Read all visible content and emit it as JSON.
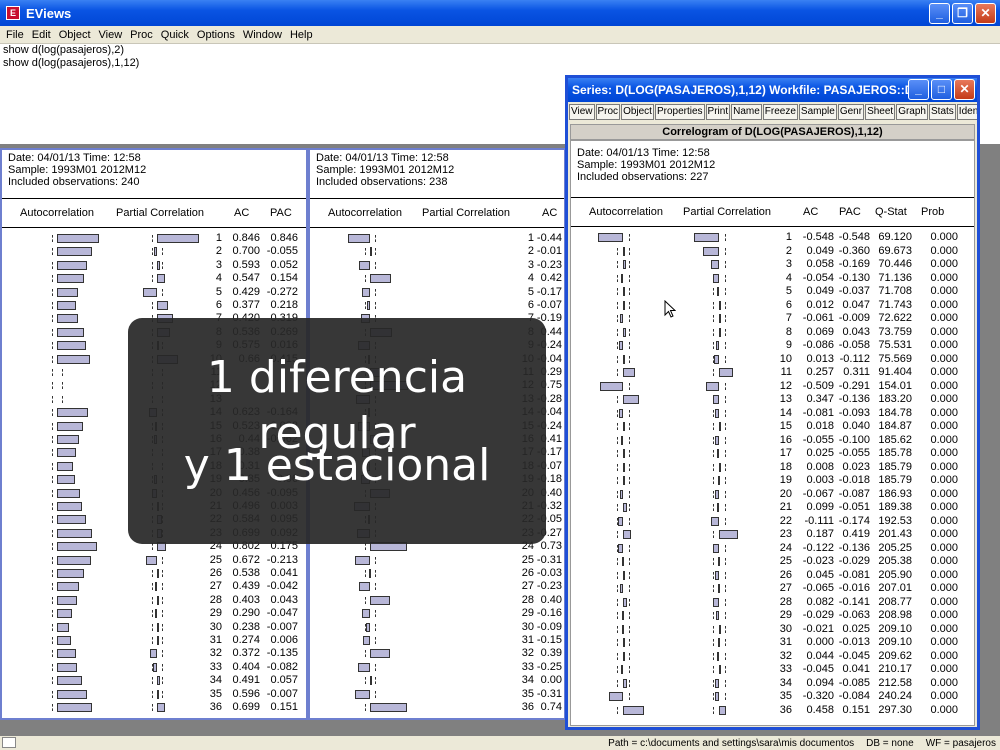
{
  "app": {
    "title": "EViews",
    "icon": "eviews-app-icon"
  },
  "menu": [
    "File",
    "Edit",
    "Object",
    "View",
    "Proc",
    "Quick",
    "Options",
    "Window",
    "Help"
  ],
  "commands": [
    "show d(log(pasajeros),2)",
    "show d(log(pasajeros),1,12)"
  ],
  "status": {
    "path": "Path = c:\\documents and settings\\sara\\mis documentos",
    "db": "DB = none",
    "wf": "WF = pasajeros"
  },
  "headers": {
    "autocorrelation": "Autocorrelation",
    "partial": "Partial Correlation",
    "ac": "AC",
    "pac": "PAC",
    "qstat": "Q-Stat",
    "prob": "Prob"
  },
  "win1": {
    "date": "Date: 04/01/13   Time: 12:58",
    "sample": "Sample: 1993M01 2012M12",
    "obs": "Included observations: 240",
    "rows": [
      {
        "lag": "1",
        "ac": "0.846",
        "pac": "0.846"
      },
      {
        "lag": "2",
        "ac": "0.700",
        "pac": "-0.055"
      },
      {
        "lag": "3",
        "ac": "0.593",
        "pac": "0.052"
      },
      {
        "lag": "4",
        "ac": "0.547",
        "pac": "0.154"
      },
      {
        "lag": "5",
        "ac": "0.429",
        "pac": "-0.272"
      },
      {
        "lag": "6",
        "ac": "0.377",
        "pac": "0.218"
      },
      {
        "lag": "7",
        "ac": "0.420",
        "pac": "0.319"
      },
      {
        "lag": "8",
        "ac": "0.536",
        "pac": "0.269"
      },
      {
        "lag": "9",
        "ac": "0.575",
        "pac": "0.016"
      },
      {
        "lag": "10",
        "ac": "0.66",
        "pac": "0.415"
      },
      {
        "lag": "11",
        "ac": "",
        "pac": ""
      },
      {
        "lag": "12",
        "ac": "",
        "pac": ""
      },
      {
        "lag": "13",
        "ac": "",
        "pac": ""
      },
      {
        "lag": "14",
        "ac": "0.623",
        "pac": "-0.164"
      },
      {
        "lag": "15",
        "ac": "0.523",
        "pac": "-0.032"
      },
      {
        "lag": "16",
        "ac": "0.44",
        "pac": "-0.062"
      },
      {
        "lag": "17",
        "ac": "0.38",
        "pac": ""
      },
      {
        "lag": "18",
        "ac": "0.31",
        "pac": ""
      },
      {
        "lag": "19",
        "ac": "0.35",
        "pac": "-0.06"
      },
      {
        "lag": "20",
        "ac": "0.456",
        "pac": "-0.095"
      },
      {
        "lag": "21",
        "ac": "0.496",
        "pac": "0.003"
      },
      {
        "lag": "22",
        "ac": "0.584",
        "pac": "0.095"
      },
      {
        "lag": "23",
        "ac": "0.699",
        "pac": "0.092"
      },
      {
        "lag": "24",
        "ac": "0.802",
        "pac": "0.175"
      },
      {
        "lag": "25",
        "ac": "0.672",
        "pac": "-0.213"
      },
      {
        "lag": "26",
        "ac": "0.538",
        "pac": "0.041"
      },
      {
        "lag": "27",
        "ac": "0.439",
        "pac": "-0.042"
      },
      {
        "lag": "28",
        "ac": "0.403",
        "pac": "0.043"
      },
      {
        "lag": "29",
        "ac": "0.290",
        "pac": "-0.047"
      },
      {
        "lag": "30",
        "ac": "0.238",
        "pac": "-0.007"
      },
      {
        "lag": "31",
        "ac": "0.274",
        "pac": "0.006"
      },
      {
        "lag": "32",
        "ac": "0.372",
        "pac": "-0.135"
      },
      {
        "lag": "33",
        "ac": "0.404",
        "pac": "-0.082"
      },
      {
        "lag": "34",
        "ac": "0.491",
        "pac": "0.057"
      },
      {
        "lag": "35",
        "ac": "0.596",
        "pac": "-0.007"
      },
      {
        "lag": "36",
        "ac": "0.699",
        "pac": "0.151"
      }
    ]
  },
  "win2": {
    "date": "Date: 04/01/13   Time: 12:58",
    "sample": "Sample: 1993M01 2012M12",
    "obs": "Included observations: 238",
    "rows": [
      {
        "lag": "1",
        "ac": "-0.44"
      },
      {
        "lag": "2",
        "ac": "-0.01"
      },
      {
        "lag": "3",
        "ac": "-0.23"
      },
      {
        "lag": "4",
        "ac": "0.42"
      },
      {
        "lag": "5",
        "ac": "-0.17"
      },
      {
        "lag": "6",
        "ac": "-0.07"
      },
      {
        "lag": "7",
        "ac": "-0.19"
      },
      {
        "lag": "8",
        "ac": "0.44"
      },
      {
        "lag": "9",
        "ac": "-0.24"
      },
      {
        "lag": "10",
        "ac": "-0.04"
      },
      {
        "lag": "11",
        "ac": "0.29"
      },
      {
        "lag": "12",
        "ac": "0.75"
      },
      {
        "lag": "13",
        "ac": "-0.28"
      },
      {
        "lag": "14",
        "ac": "-0.04"
      },
      {
        "lag": "15",
        "ac": "-0.24"
      },
      {
        "lag": "16",
        "ac": "0.41"
      },
      {
        "lag": "17",
        "ac": "-0.17"
      },
      {
        "lag": "18",
        "ac": "-0.07"
      },
      {
        "lag": "19",
        "ac": "-0.18"
      },
      {
        "lag": "20",
        "ac": "0.40"
      },
      {
        "lag": "21",
        "ac": "-0.32"
      },
      {
        "lag": "22",
        "ac": "-0.05"
      },
      {
        "lag": "23",
        "ac": "-0.27"
      },
      {
        "lag": "24",
        "ac": "0.73"
      },
      {
        "lag": "25",
        "ac": "-0.31"
      },
      {
        "lag": "26",
        "ac": "-0.03"
      },
      {
        "lag": "27",
        "ac": "-0.23"
      },
      {
        "lag": "28",
        "ac": "0.40"
      },
      {
        "lag": "29",
        "ac": "-0.16"
      },
      {
        "lag": "30",
        "ac": "-0.09"
      },
      {
        "lag": "31",
        "ac": "-0.15"
      },
      {
        "lag": "32",
        "ac": "0.39"
      },
      {
        "lag": "33",
        "ac": "-0.25"
      },
      {
        "lag": "34",
        "ac": "0.00"
      },
      {
        "lag": "35",
        "ac": "-0.31"
      },
      {
        "lag": "36",
        "ac": "0.74"
      }
    ]
  },
  "win3": {
    "title": "Series: D(LOG(PASAJEROS),1,12)   Workfile: PASAJEROS::D...",
    "toolbar": [
      "View",
      "Proc",
      "Object",
      "Properties",
      "Print",
      "Name",
      "Freeze",
      "Sample",
      "Genr",
      "Sheet",
      "Graph",
      "Stats",
      "Ident"
    ],
    "label": "Correlogram of D(LOG(PASAJEROS),1,12)",
    "date": "Date: 04/01/13   Time: 12:58",
    "sample": "Sample: 1993M01 2012M12",
    "obs": "Included observations: 227",
    "rows": [
      {
        "lag": "1",
        "ac": "-0.548",
        "pac": "-0.548",
        "q": "69.120",
        "p": "0.000"
      },
      {
        "lag": "2",
        "ac": "0.049",
        "pac": "-0.360",
        "q": "69.673",
        "p": "0.000"
      },
      {
        "lag": "3",
        "ac": "0.058",
        "pac": "-0.169",
        "q": "70.446",
        "p": "0.000"
      },
      {
        "lag": "4",
        "ac": "-0.054",
        "pac": "-0.130",
        "q": "71.136",
        "p": "0.000"
      },
      {
        "lag": "5",
        "ac": "0.049",
        "pac": "-0.037",
        "q": "71.708",
        "p": "0.000"
      },
      {
        "lag": "6",
        "ac": "0.012",
        "pac": "0.047",
        "q": "71.743",
        "p": "0.000"
      },
      {
        "lag": "7",
        "ac": "-0.061",
        "pac": "-0.009",
        "q": "72.622",
        "p": "0.000"
      },
      {
        "lag": "8",
        "ac": "0.069",
        "pac": "0.043",
        "q": "73.759",
        "p": "0.000"
      },
      {
        "lag": "9",
        "ac": "-0.086",
        "pac": "-0.058",
        "q": "75.531",
        "p": "0.000"
      },
      {
        "lag": "10",
        "ac": "0.013",
        "pac": "-0.112",
        "q": "75.569",
        "p": "0.000"
      },
      {
        "lag": "11",
        "ac": "0.257",
        "pac": "0.311",
        "q": "91.404",
        "p": "0.000"
      },
      {
        "lag": "12",
        "ac": "-0.509",
        "pac": "-0.291",
        "q": "154.01",
        "p": "0.000"
      },
      {
        "lag": "13",
        "ac": "0.347",
        "pac": "-0.136",
        "q": "183.20",
        "p": "0.000"
      },
      {
        "lag": "14",
        "ac": "-0.081",
        "pac": "-0.093",
        "q": "184.78",
        "p": "0.000"
      },
      {
        "lag": "15",
        "ac": "0.018",
        "pac": "0.040",
        "q": "184.87",
        "p": "0.000"
      },
      {
        "lag": "16",
        "ac": "-0.055",
        "pac": "-0.100",
        "q": "185.62",
        "p": "0.000"
      },
      {
        "lag": "17",
        "ac": "0.025",
        "pac": "-0.055",
        "q": "185.78",
        "p": "0.000"
      },
      {
        "lag": "18",
        "ac": "0.008",
        "pac": "0.023",
        "q": "185.79",
        "p": "0.000"
      },
      {
        "lag": "19",
        "ac": "0.003",
        "pac": "-0.018",
        "q": "185.79",
        "p": "0.000"
      },
      {
        "lag": "20",
        "ac": "-0.067",
        "pac": "-0.087",
        "q": "186.93",
        "p": "0.000"
      },
      {
        "lag": "21",
        "ac": "0.099",
        "pac": "-0.051",
        "q": "189.38",
        "p": "0.000"
      },
      {
        "lag": "22",
        "ac": "-0.111",
        "pac": "-0.174",
        "q": "192.53",
        "p": "0.000"
      },
      {
        "lag": "23",
        "ac": "0.187",
        "pac": "0.419",
        "q": "201.43",
        "p": "0.000"
      },
      {
        "lag": "24",
        "ac": "-0.122",
        "pac": "-0.136",
        "q": "205.25",
        "p": "0.000"
      },
      {
        "lag": "25",
        "ac": "-0.023",
        "pac": "-0.029",
        "q": "205.38",
        "p": "0.000"
      },
      {
        "lag": "26",
        "ac": "0.045",
        "pac": "-0.081",
        "q": "205.90",
        "p": "0.000"
      },
      {
        "lag": "27",
        "ac": "-0.065",
        "pac": "-0.016",
        "q": "207.01",
        "p": "0.000"
      },
      {
        "lag": "28",
        "ac": "0.082",
        "pac": "-0.141",
        "q": "208.77",
        "p": "0.000"
      },
      {
        "lag": "29",
        "ac": "-0.029",
        "pac": "-0.063",
        "q": "208.98",
        "p": "0.000"
      },
      {
        "lag": "30",
        "ac": "-0.021",
        "pac": "0.025",
        "q": "209.10",
        "p": "0.000"
      },
      {
        "lag": "31",
        "ac": "0.000",
        "pac": "-0.013",
        "q": "209.10",
        "p": "0.000"
      },
      {
        "lag": "32",
        "ac": "0.044",
        "pac": "-0.045",
        "q": "209.62",
        "p": "0.000"
      },
      {
        "lag": "33",
        "ac": "-0.045",
        "pac": "0.041",
        "q": "210.17",
        "p": "0.000"
      },
      {
        "lag": "34",
        "ac": "0.094",
        "pac": "-0.085",
        "q": "212.58",
        "p": "0.000"
      },
      {
        "lag": "35",
        "ac": "-0.320",
        "pac": "-0.084",
        "q": "240.24",
        "p": "0.000"
      },
      {
        "lag": "36",
        "ac": "0.458",
        "pac": "0.151",
        "q": "297.30",
        "p": "0.000"
      }
    ]
  },
  "overlay": {
    "line1": "1 diferencia regular",
    "line2": "y 1 estacional"
  },
  "colors": {
    "titlebar": "#0a54e3",
    "bar_fill": "#b8b7d8",
    "overlay_bg": "#282828"
  }
}
